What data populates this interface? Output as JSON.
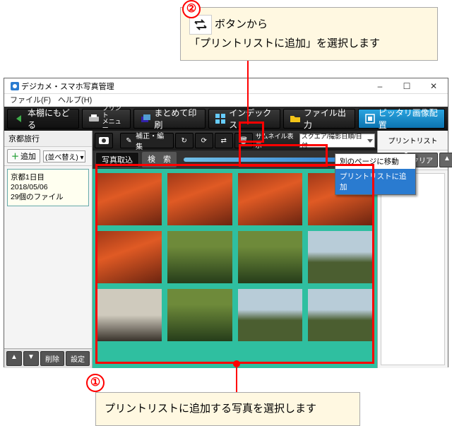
{
  "callouts": {
    "top": {
      "num": "②",
      "line1": "ボタンから",
      "line2": "「プリントリストに追加」を選択します"
    },
    "bottom": {
      "num": "①",
      "text": "プリントリストに追加する写真を選択します"
    }
  },
  "window": {
    "title": "デジカメ・スマホ写真管理",
    "min": "–",
    "max": "☐",
    "close": "✕"
  },
  "menu": {
    "file": "ファイル(F)",
    "help": "ヘルプ(H)"
  },
  "toolbar": {
    "back": "本棚にもどる",
    "print_menu_l1": "プリント",
    "print_menu_l2": "メニュー",
    "batch_print": "まとめて印刷",
    "index": "インデックス",
    "file_out": "ファイル出力",
    "fit": "ピッタリ画像配置"
  },
  "sidebar": {
    "heading": "京都旅行",
    "add": "追加",
    "sort": "(並べ替え)",
    "item": {
      "l1": "京都1日目",
      "l2": "2018/05/06",
      "l3": "29個のファイル"
    },
    "up": "▲",
    "down": "▼",
    "delete": "削除",
    "settings": "設定"
  },
  "center": {
    "correct": "補正・編集",
    "thumb_label": "サムネイル表示",
    "thumb_mode": "スクエア/撮影日順/日付",
    "tab_import": "写真取込",
    "tab_search": "検　索"
  },
  "dropdown": {
    "move": "別のページに移動",
    "add_print": "プリントリストに追加"
  },
  "print_list": {
    "title": "プリントリスト",
    "clear_all": "すべてクリア",
    "clear": "クリア",
    "up": "▲",
    "down": "▼"
  }
}
